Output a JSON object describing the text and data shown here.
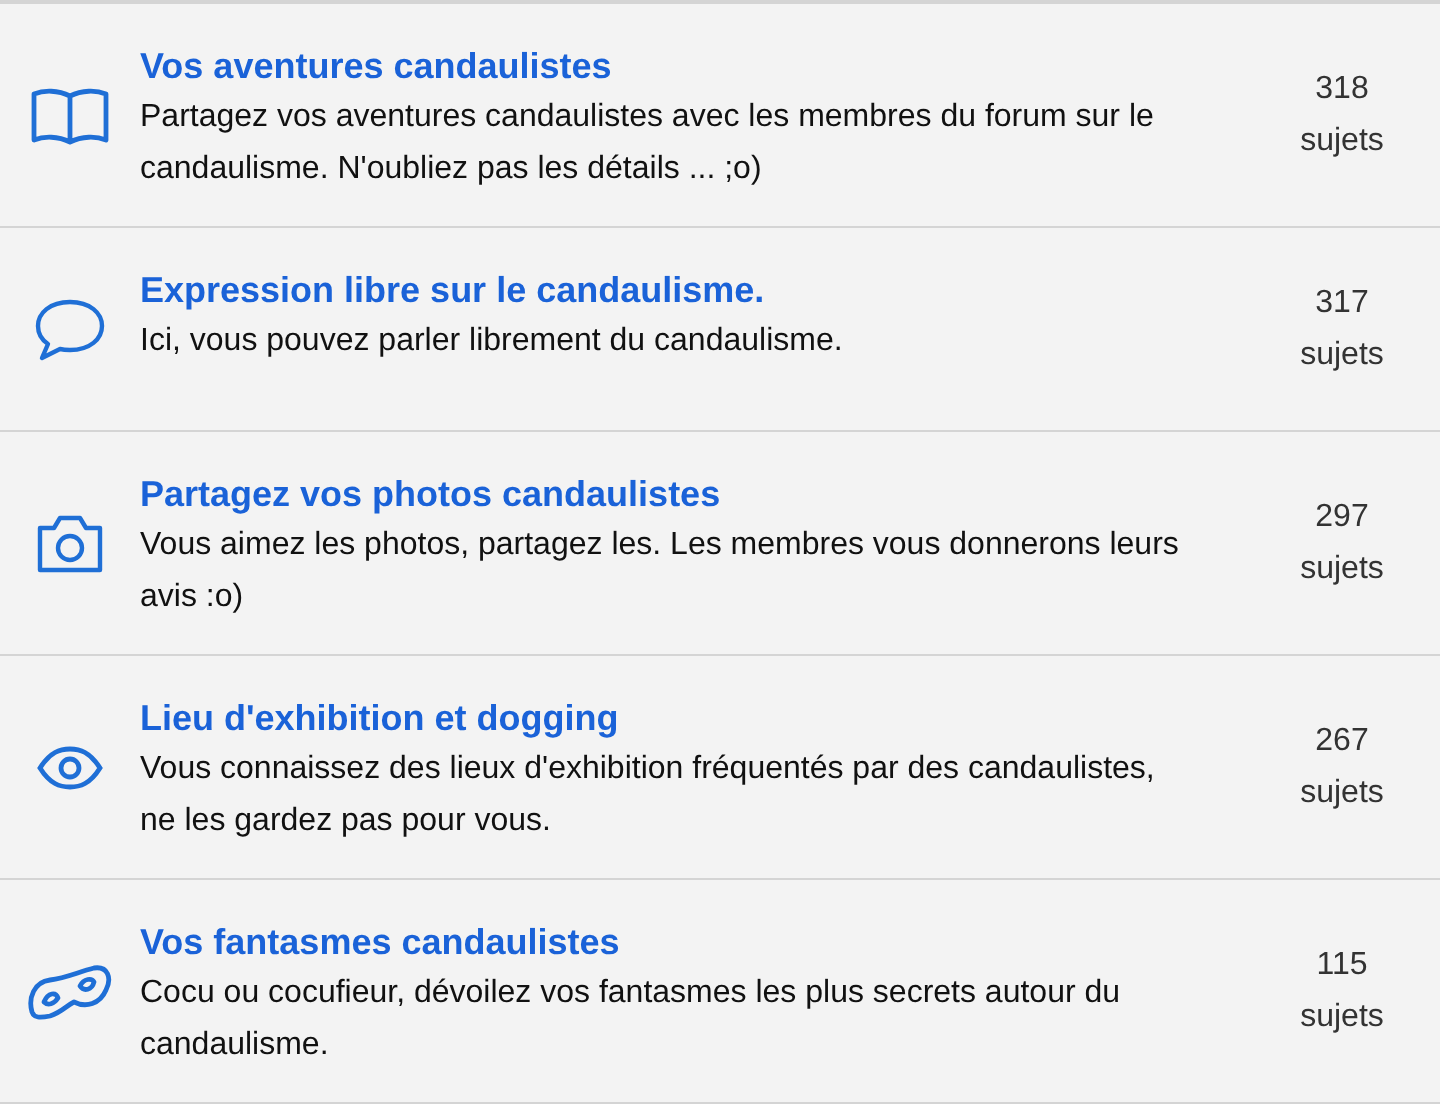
{
  "forums": [
    {
      "kind": "book",
      "title": "Vos aventures candaulistes",
      "description": "Partagez vos aventures candaulistes avec les membres du forum sur le candaulisme. N'oubliez pas les détails ... ;o)",
      "count": "318",
      "unit": "sujets"
    },
    {
      "kind": "bubble",
      "title": "Expression libre sur le candaulisme.",
      "description": "Ici, vous pouvez parler librement du candaulisme.",
      "count": "317",
      "unit": "sujets"
    },
    {
      "kind": "camera",
      "title": "Partagez vos photos candaulistes",
      "description": "Vous aimez les photos, partagez les. Les membres vous donnerons leurs avis :o)",
      "count": "297",
      "unit": "sujets"
    },
    {
      "kind": "eye",
      "title": "Lieu d'exhibition et dogging",
      "description": "Vous connaissez des lieux d'exhibition fréquentés par des candaulistes, ne les gardez pas pour vous.",
      "count": "267",
      "unit": "sujets"
    },
    {
      "kind": "mask",
      "title": "Vos fantasmes candaulistes",
      "description": "Cocu ou cocufieur, dévoilez vos fantasmes les plus secrets autour du candaulisme.",
      "count": "115",
      "unit": "sujets"
    }
  ]
}
